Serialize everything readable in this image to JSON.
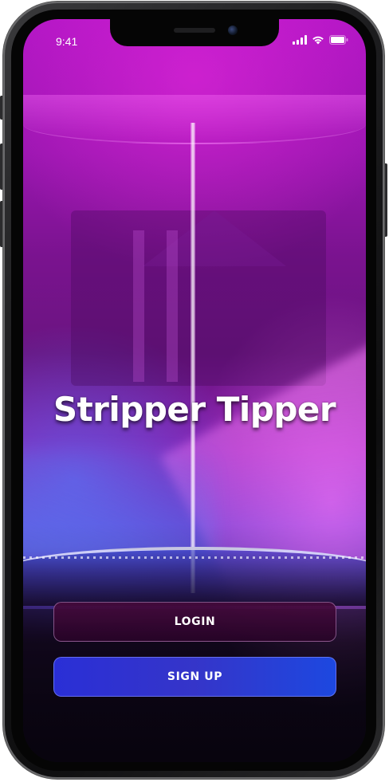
{
  "status_bar": {
    "time": "9:41",
    "icons": [
      "signal-icon",
      "wifi-icon",
      "battery-icon"
    ],
    "color": "#ffffff"
  },
  "app": {
    "title": "Stripper Tipper"
  },
  "actions": {
    "login_label": "LOGIN",
    "signup_label": "SIGN UP"
  },
  "colors": {
    "background_top": "#b015c4",
    "background_mid": "#6a36c8",
    "login_button": "#3a0534",
    "signup_button": "#2a2fd6",
    "text": "#ffffff"
  }
}
